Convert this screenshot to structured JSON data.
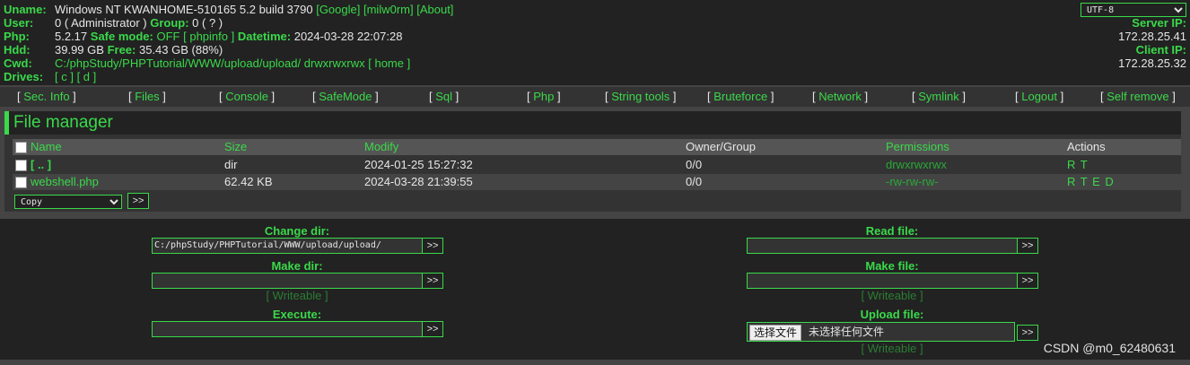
{
  "info": {
    "uname_label": "Uname:",
    "uname_value": "Windows NT KWANHOME-510165 5.2 build 3790",
    "uname_links": [
      "[Google]",
      "[milw0rm]",
      "[About]"
    ],
    "user_label": "User:",
    "user_value": "0 ( Administrator )",
    "group_label": "Group:",
    "group_value": "0 ( ? )",
    "php_label": "Php:",
    "php_value": "5.2.17",
    "safe_mode_label": "Safe mode:",
    "safe_mode_value": "OFF",
    "phpinfo_link": "[ phpinfo ]",
    "datetime_label": "Datetime:",
    "datetime_value": "2024-03-28 22:07:28",
    "hdd_label": "Hdd:",
    "hdd_value": "39.99 GB",
    "free_label": "Free:",
    "free_value": "35.43 GB (88%)",
    "cwd_label": "Cwd:",
    "cwd_path": "C:/phpStudy/PHPTutorial/WWW/upload/upload/",
    "cwd_perms": "drwxrwxrwx",
    "home_link": "[ home ]",
    "drives_label": "Drives:",
    "drives": [
      "[ c ]",
      "[ d ]"
    ]
  },
  "charset": {
    "selected": "UTF-8"
  },
  "server": {
    "server_ip_label": "Server IP:",
    "server_ip": "172.28.25.41",
    "client_ip_label": "Client IP:",
    "client_ip": "172.28.25.32"
  },
  "menu": [
    "Sec. Info",
    "Files",
    "Console",
    "SafeMode",
    "Sql",
    "Php",
    "String tools",
    "Bruteforce",
    "Network",
    "Symlink",
    "Logout",
    "Self remove"
  ],
  "file_manager": {
    "title": "File manager",
    "headers": [
      "Name",
      "Size",
      "Modify",
      "Owner/Group",
      "Permissions",
      "Actions"
    ],
    "rows": [
      {
        "name": "[ .. ]",
        "size": "dir",
        "modify": "2024-01-25 15:27:32",
        "owner": "0/0",
        "perms": "drwxrwxrwx",
        "actions": "R T"
      },
      {
        "name": "webshell.php",
        "size": "62.42 KB",
        "modify": "2024-03-28 21:39:55",
        "owner": "0/0",
        "perms": "-rw-rw-rw-",
        "actions": "R T E D"
      }
    ],
    "action_select": "Copy",
    "go": ">>"
  },
  "forms": {
    "change_dir_label": "Change dir:",
    "change_dir_value": "C:/phpStudy/PHPTutorial/WWW/upload/upload/",
    "make_dir_label": "Make dir:",
    "make_dir_value": "",
    "writeable": "[ Writeable ]",
    "execute_label": "Execute:",
    "execute_value": "",
    "read_file_label": "Read file:",
    "read_file_value": "",
    "make_file_label": "Make file:",
    "make_file_value": "",
    "upload_label": "Upload file:",
    "upload_button": "选择文件",
    "upload_status": "未选择任何文件",
    "go": ">>"
  },
  "watermark": "CSDN @m0_62480631",
  "colors": {
    "accent": "#3ad94a",
    "background": "#444444",
    "panel": "#222222"
  }
}
